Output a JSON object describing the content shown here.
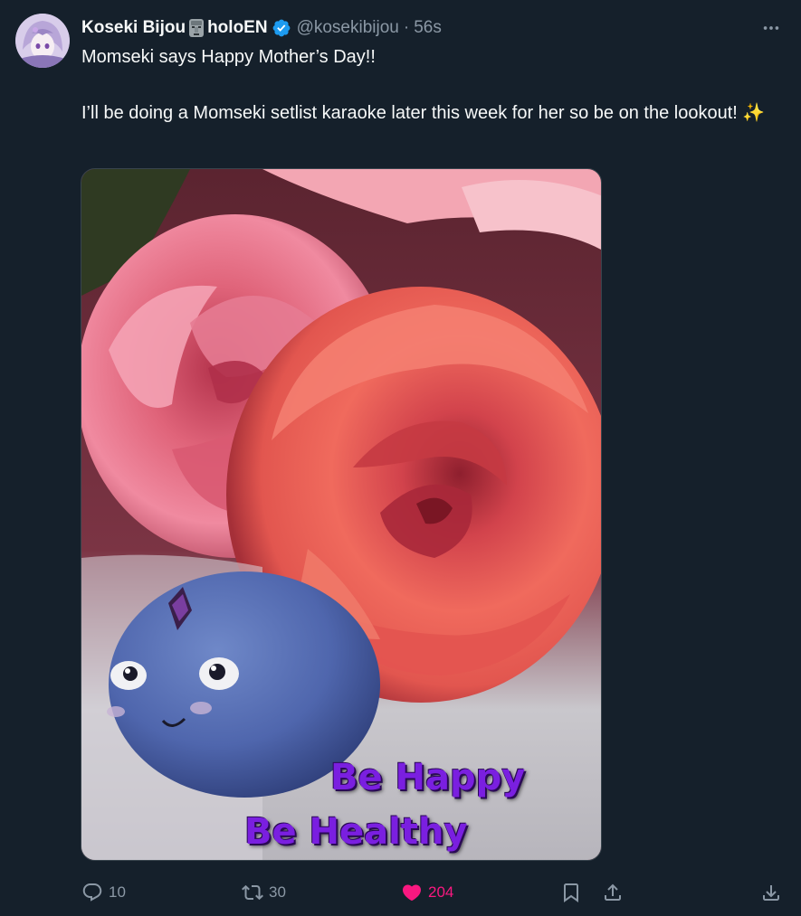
{
  "tweet": {
    "display_name": "Koseki Bijou",
    "name_suffix": "holoEN",
    "handle": "@kosekibijou",
    "separator": "·",
    "timestamp": "56s",
    "text_line1": "Momseki says Happy Mother’s Day!!",
    "text_line2": "I’ll be doing a Momseki setlist karaoke later this week for her so be on the lookout! ✨",
    "image_caption_line1": "Be Happy",
    "image_caption_line2": "Be Healthy"
  },
  "actions": {
    "replies": "10",
    "reposts": "30",
    "likes": "204"
  },
  "colors": {
    "background": "#15202b",
    "text": "#f7f9f9",
    "muted": "#8b98a5",
    "verified": "#1d9bf0",
    "like": "#f91880",
    "caption": "#7a1fe0"
  },
  "icons": [
    "avatar",
    "moai-icon",
    "verified-badge-icon",
    "more-icon",
    "reply-icon",
    "repost-icon",
    "heart-icon",
    "bookmark-icon",
    "share-icon",
    "download-icon"
  ]
}
